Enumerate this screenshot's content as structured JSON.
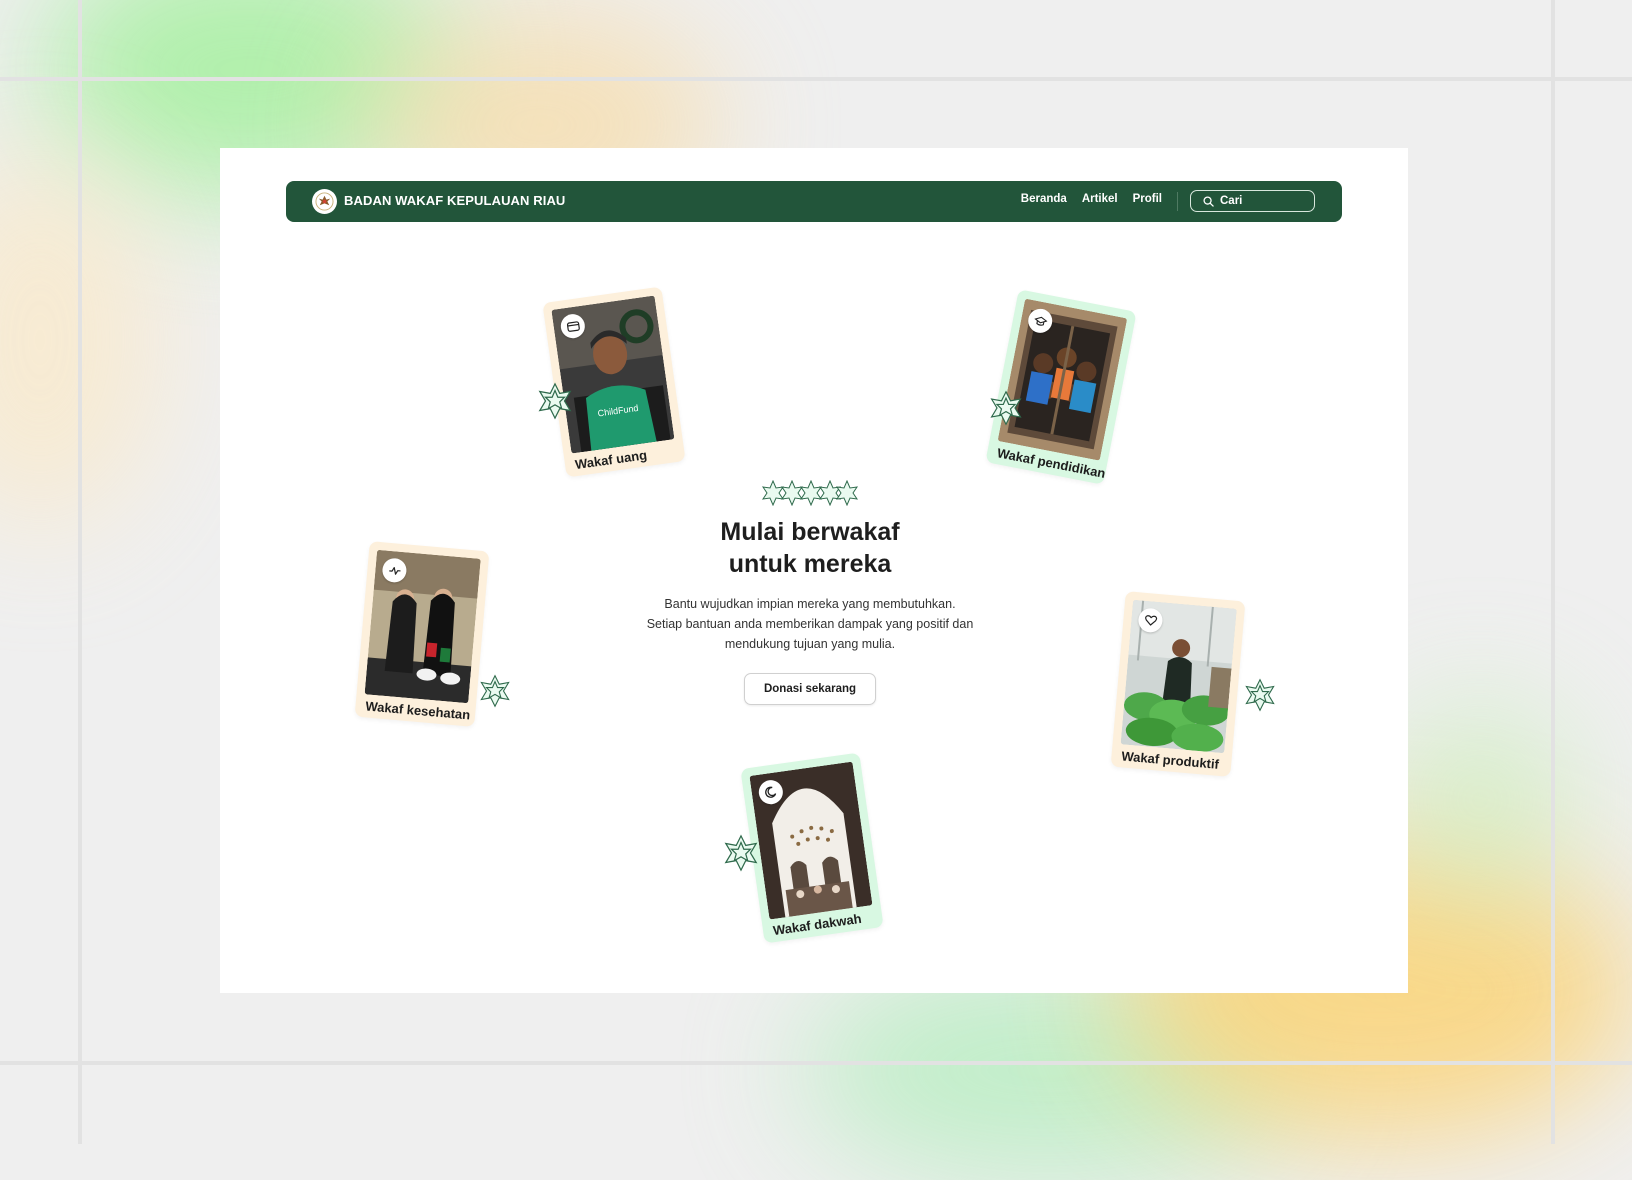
{
  "header": {
    "brand": "BADAN WAKAF KEPULAUAN RIAU",
    "nav": [
      {
        "label": "Beranda"
      },
      {
        "label": "Artikel"
      },
      {
        "label": "Profil"
      }
    ],
    "search_placeholder": "Cari"
  },
  "hero": {
    "title": "Mulai berwakaf\nuntuk mereka",
    "description": "Bantu wujudkan impian mereka yang membutuhkan. Setiap bantuan anda memberikan dampak yang positif dan mendukung tujuan yang mulia.",
    "cta_label": "Donasi sekarang"
  },
  "cards": [
    {
      "label": "Wakaf uang",
      "icon": "credit-card-icon"
    },
    {
      "label": "Wakaf pendidikan",
      "icon": "graduation-cap-icon"
    },
    {
      "label": "Wakaf kesehatan",
      "icon": "pulse-icon"
    },
    {
      "label": "Wakaf produktif",
      "icon": "heart-icon"
    },
    {
      "label": "Wakaf dakwah",
      "icon": "crescent-moon-icon"
    }
  ],
  "colors": {
    "nav_bg": "#22553a",
    "peach_card": "#fdf0dc",
    "mint_card": "#d8f8e2",
    "ornament": "#2f6a4c"
  }
}
